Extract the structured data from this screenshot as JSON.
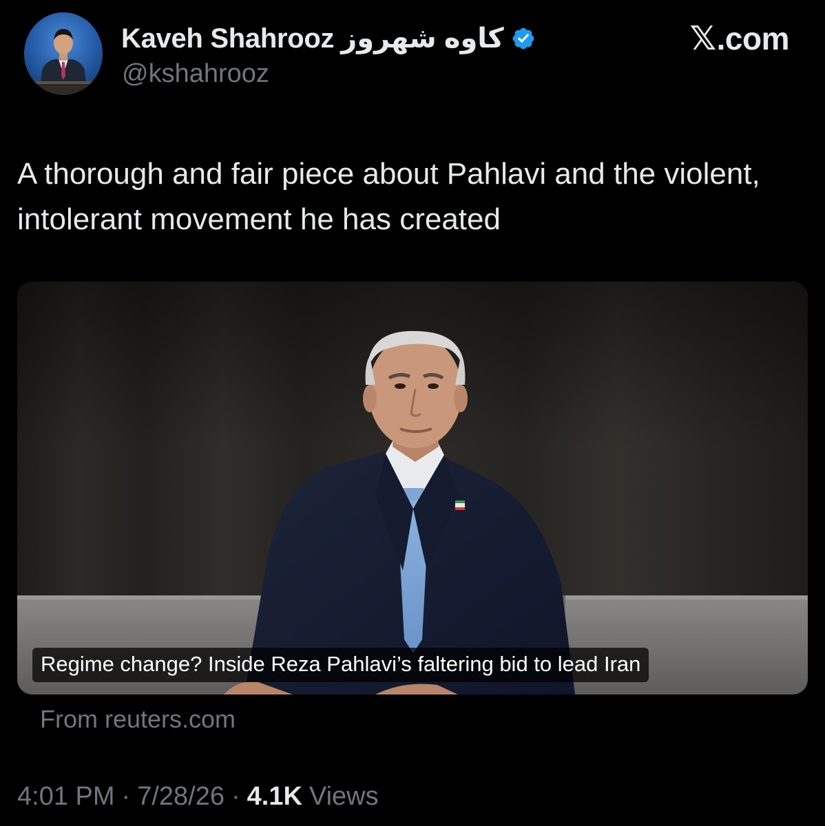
{
  "author": {
    "display_name": "Kaveh Shahrooz",
    "display_name_persian": "کاوه شهروز",
    "handle": "@kshahrooz",
    "verified_icon": "verified-badge-icon",
    "avatar_icon": "avatar"
  },
  "brand": {
    "label": ".com",
    "glyph": "𝕏"
  },
  "tweet": {
    "text": "A thorough and fair piece about Pahlavi and the violent, intolerant movement he has created"
  },
  "card": {
    "title": "Regime change? Inside Reza Pahlavi’s faltering bid to lead Iran",
    "source": "From reuters.com"
  },
  "meta": {
    "time": "4:01 PM",
    "separator": "·",
    "date": "7/28/26",
    "views_count": "4.1K",
    "views_label": "Views"
  },
  "colors": {
    "background": "#000000",
    "primary_text": "#e7e9ea",
    "secondary_text": "#71767b",
    "verified_blue": "#1d9bf0"
  }
}
